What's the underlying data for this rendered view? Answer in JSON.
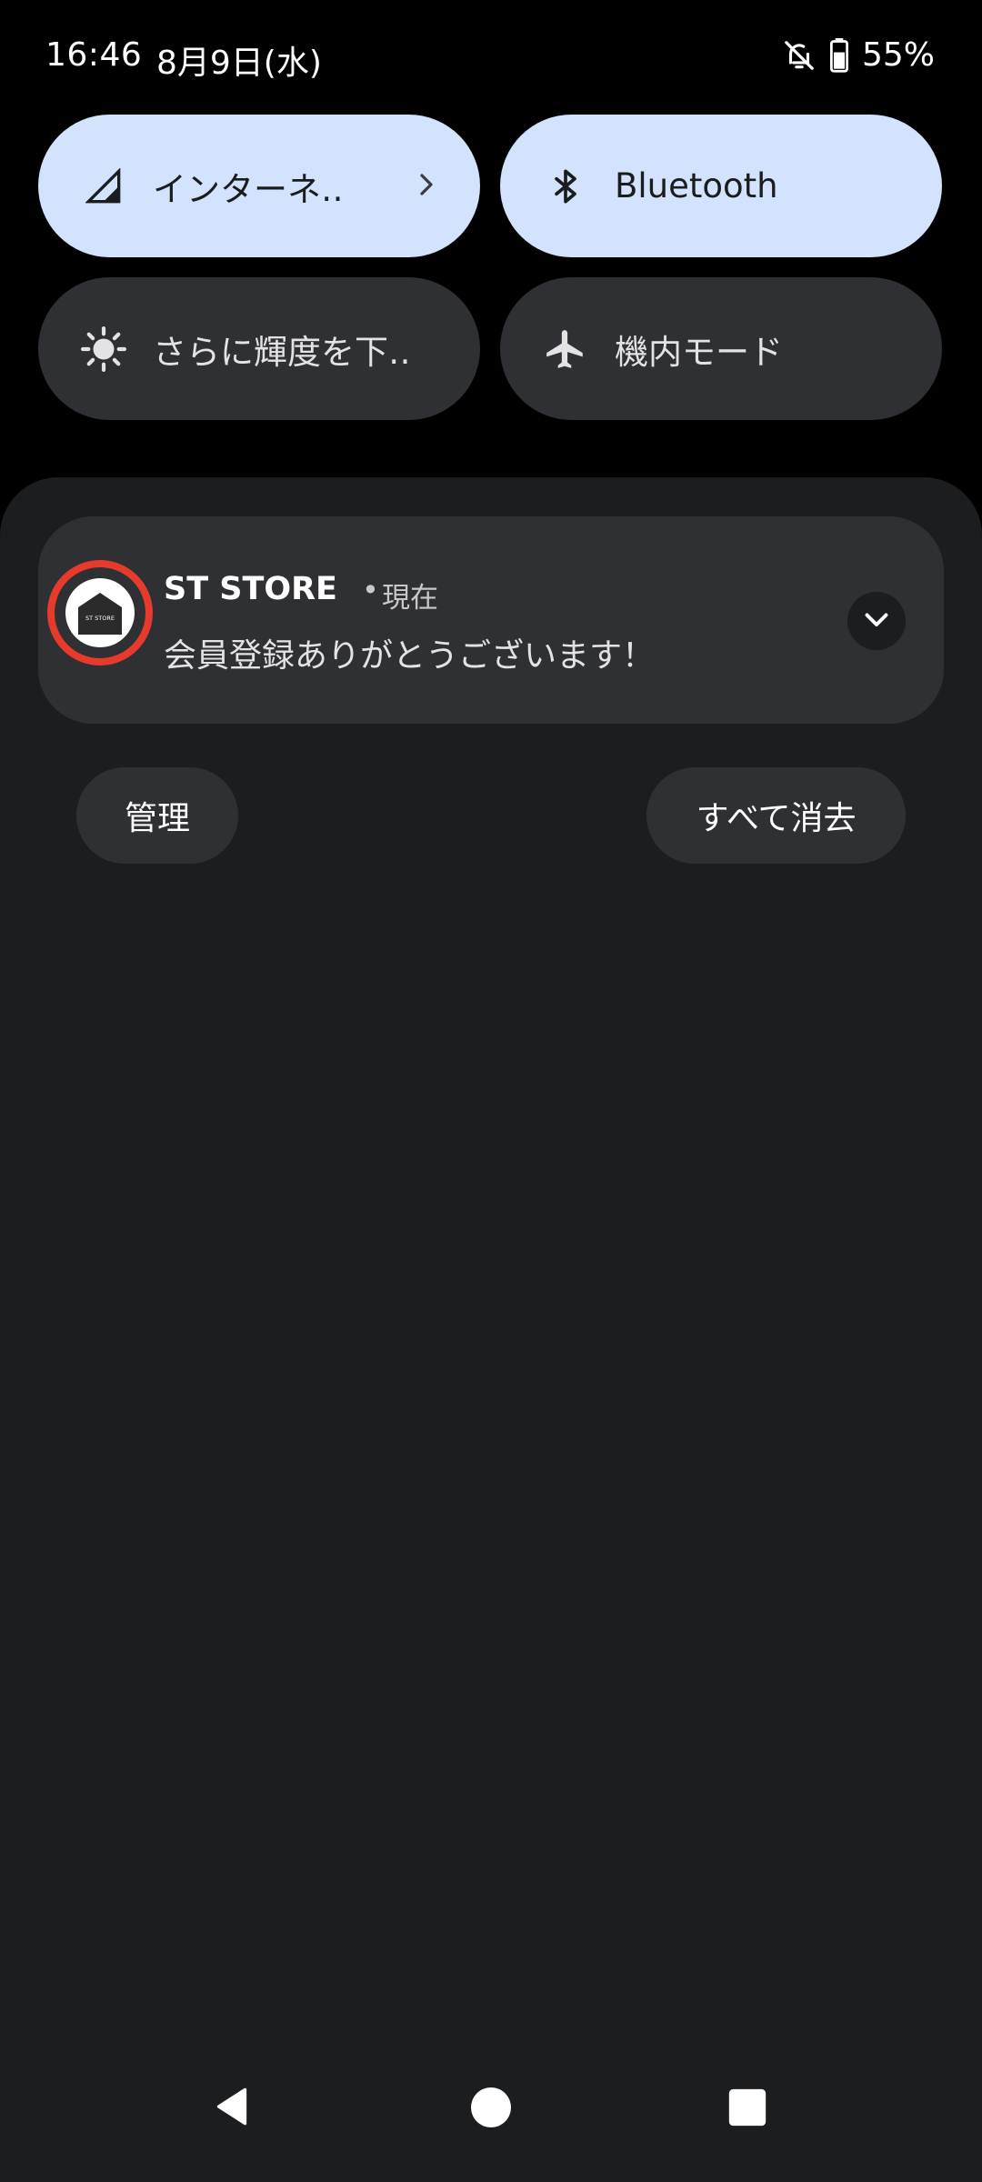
{
  "status_bar": {
    "time": "16:46",
    "date": "8月9日(水)",
    "battery": "55%",
    "icons": [
      "notifications-off-icon",
      "battery-icon"
    ]
  },
  "quick_settings": {
    "tiles": [
      {
        "label": "インターネ‥",
        "icon": "cell-signal-icon",
        "state": "on",
        "has_chevron": true
      },
      {
        "label": "Bluetooth",
        "icon": "bluetooth-icon",
        "state": "on"
      },
      {
        "label": "さらに輝度を下‥",
        "icon": "brightness-icon",
        "state": "off"
      },
      {
        "label": "機内モード",
        "icon": "airplane-icon",
        "state": "off"
      }
    ],
    "colors": {
      "on": "#d3e3fd",
      "off": "#2f3033"
    }
  },
  "notification": {
    "app_name": "ST STORE",
    "separator": "•",
    "time": "現在",
    "message": "会員登録ありがとうございます！",
    "icon_text": "ST STORE",
    "highlight_color": "#e53a2c"
  },
  "actions": {
    "manage": "管理",
    "clear_all": "すべて消去"
  },
  "nav_bar": {
    "buttons": [
      "back-icon",
      "home-icon",
      "recents-icon"
    ]
  }
}
